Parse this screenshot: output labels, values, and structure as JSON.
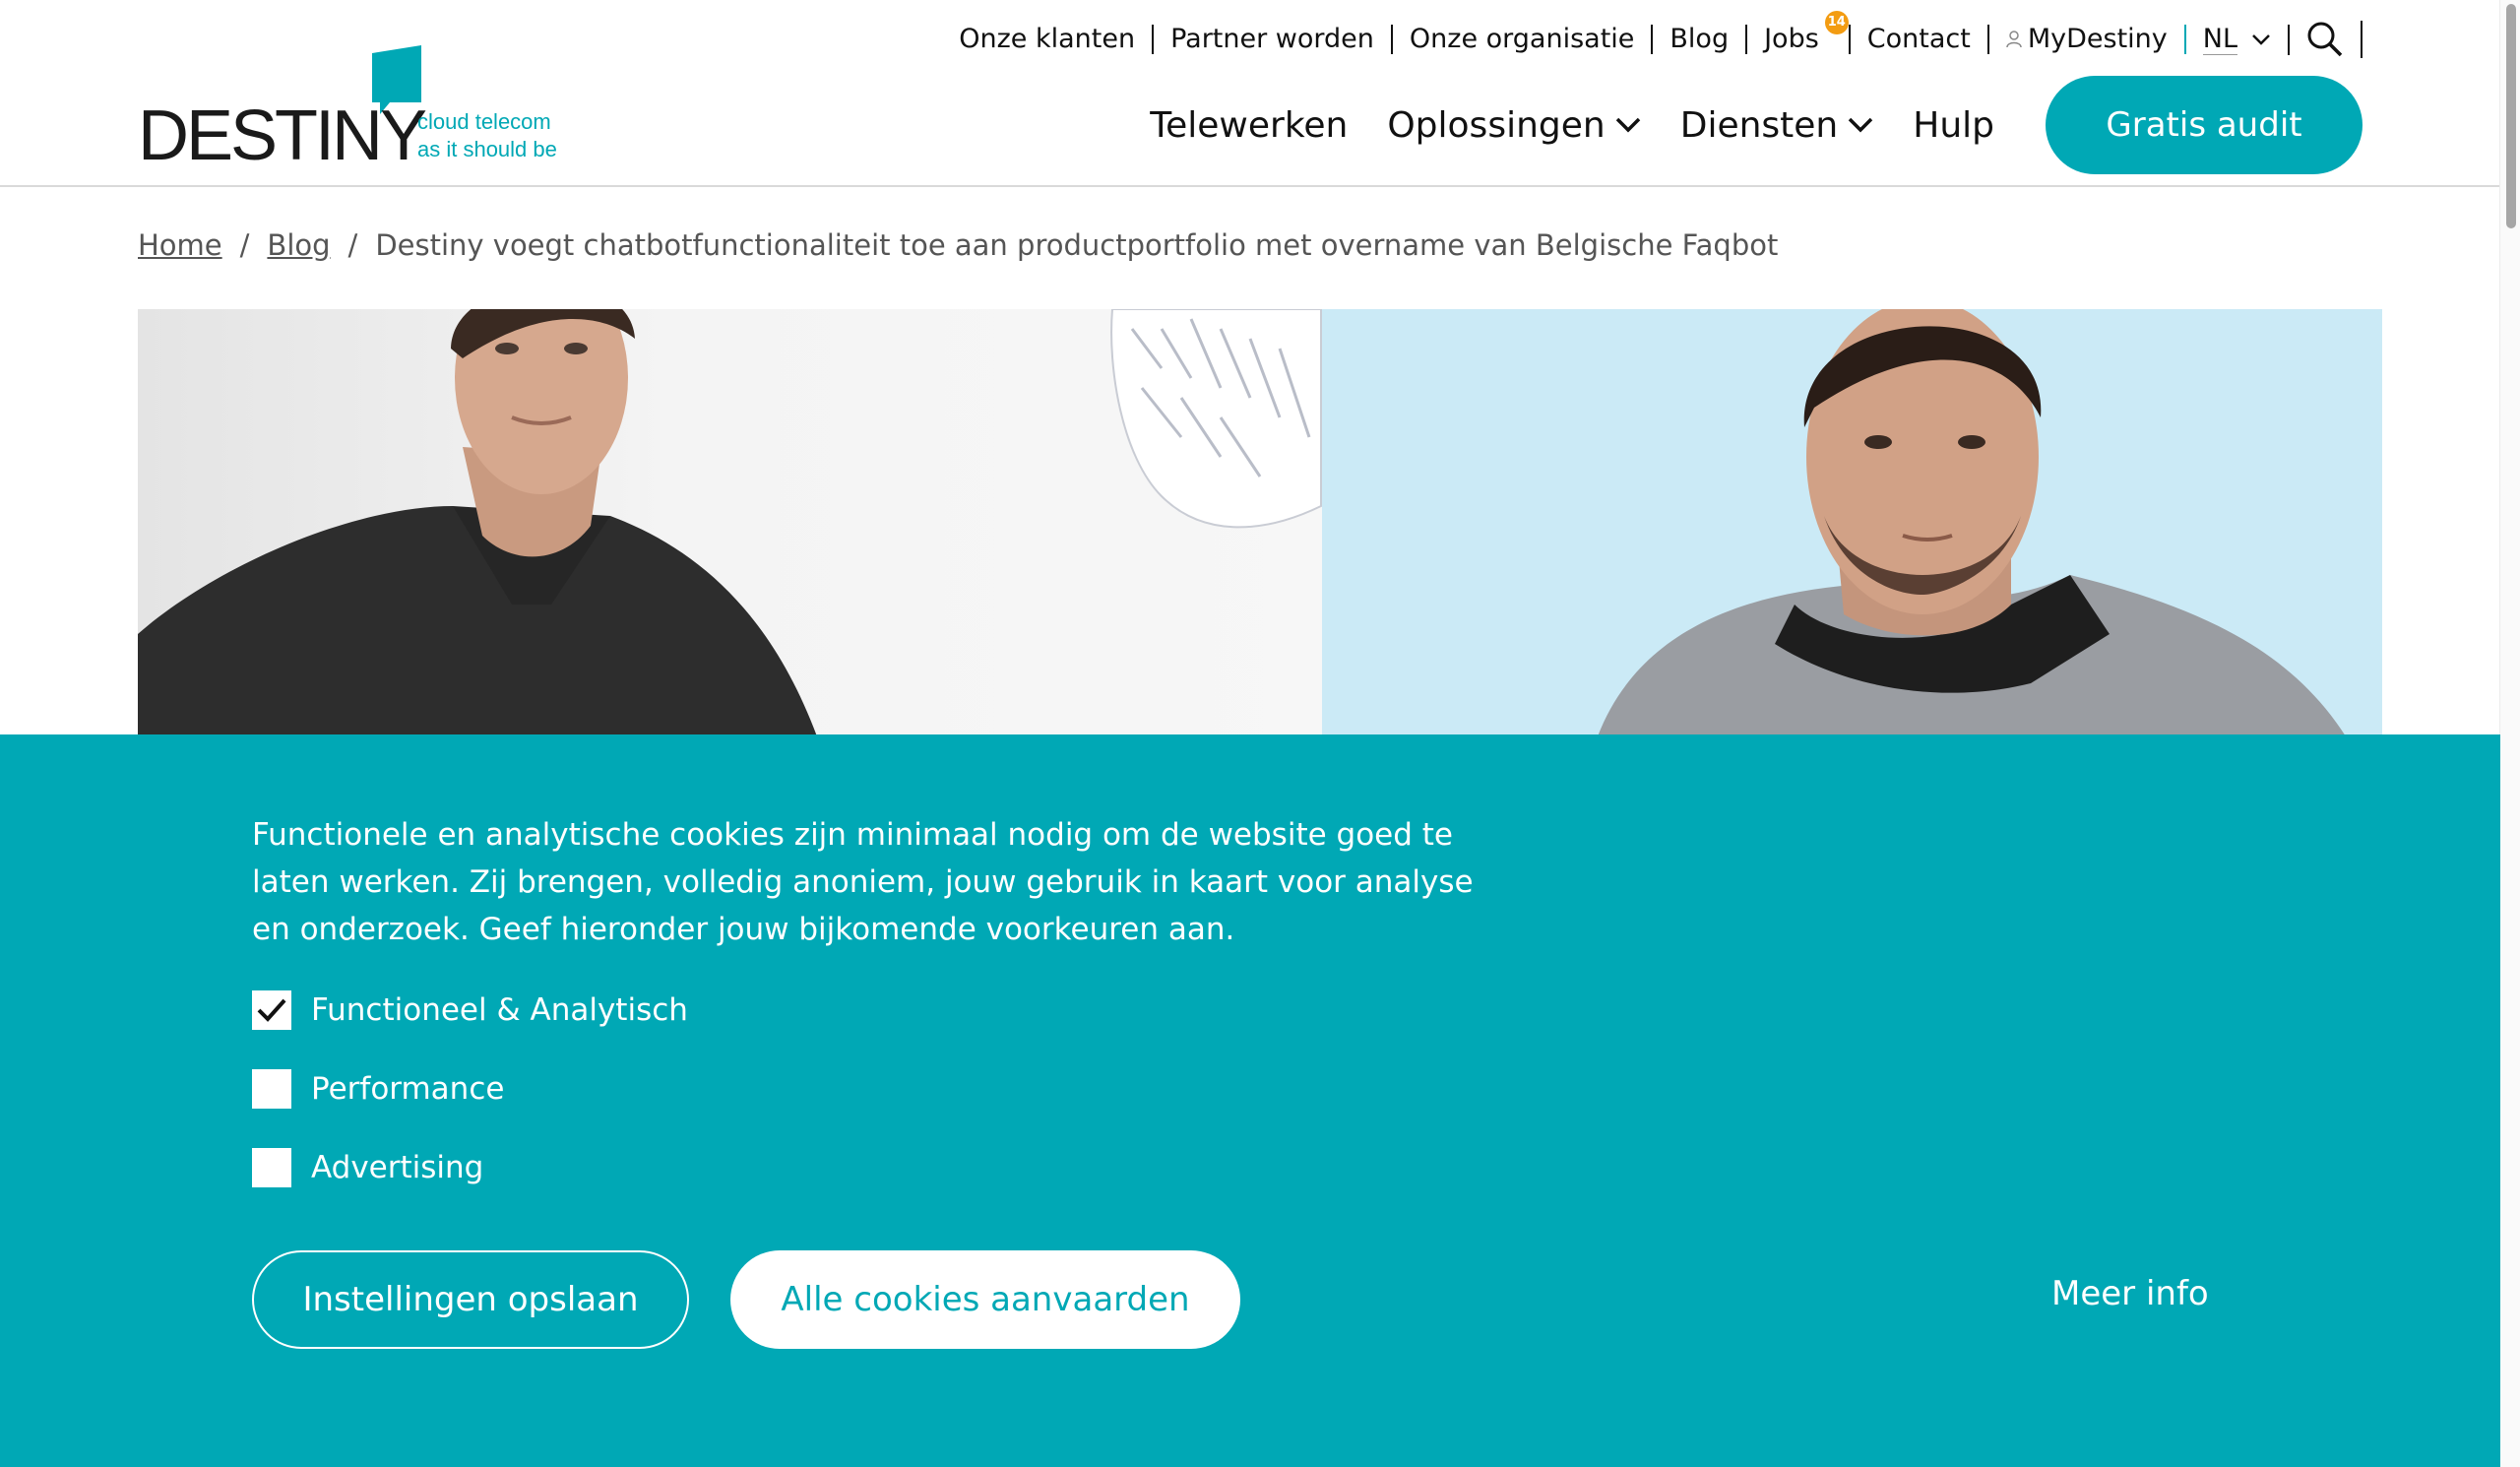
{
  "brand": {
    "name": "DESTINY",
    "tagline_1": "cloud telecom",
    "tagline_2": "as it should be",
    "accent": "#00a8b5"
  },
  "topnav": {
    "items": [
      "Onze klanten",
      "Partner worden",
      "Onze organisatie",
      "Blog",
      "Jobs",
      "Contact"
    ],
    "jobs_badge": "14",
    "mydestiny": "MyDestiny",
    "language": "NL"
  },
  "mainnav": {
    "items": [
      "Telewerken",
      "Oplossingen",
      "Diensten",
      "Hulp"
    ],
    "cta": "Gratis audit"
  },
  "breadcrumb": {
    "home": "Home",
    "blog": "Blog",
    "current": "Destiny voegt chatbotfunctionaliteit toe aan productportfolio met overname van Belgische Faqbot",
    "separator": "/"
  },
  "cookie_banner": {
    "text": "Functionele en analytische cookies zijn minimaal nodig om de website goed te laten werken. Zij brengen, volledig anoniem, jouw gebruik in kaart voor analyse en onderzoek. Geef hieronder jouw bijkomende voorkeuren aan.",
    "options": [
      {
        "label": "Functioneel & Analytisch",
        "checked": true
      },
      {
        "label": "Performance",
        "checked": false
      },
      {
        "label": "Advertising",
        "checked": false
      }
    ],
    "save_button": "Instellingen opslaan",
    "accept_button": "Alle cookies aanvaarden",
    "more_info": "Meer info"
  }
}
